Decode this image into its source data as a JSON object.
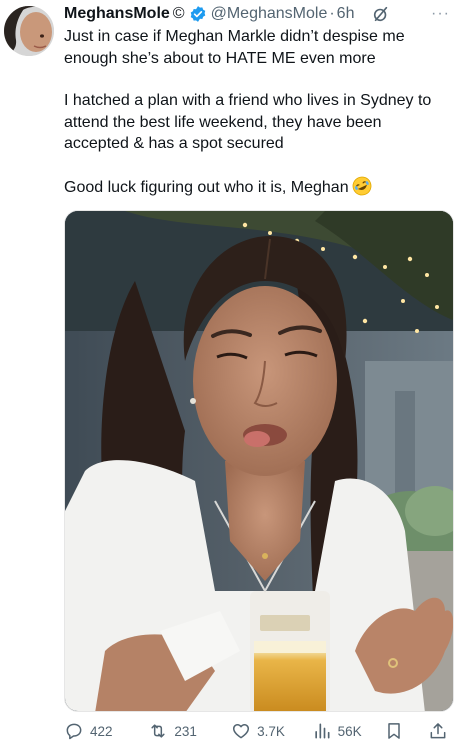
{
  "author": {
    "display_name": "MeghansMole",
    "name_suffix": "©",
    "handle": "@MeghansMole",
    "separator": "·",
    "time": "6h",
    "verified": true
  },
  "icons": {
    "verified": "verified-badge-icon",
    "grok": "grok-icon",
    "more": "more-options-icon",
    "emoji": "rolling-on-floor-laughing-emoji",
    "reply": "reply-icon",
    "retweet": "retweet-icon",
    "like": "heart-icon",
    "views": "views-icon",
    "bookmark": "bookmark-icon",
    "share": "share-icon"
  },
  "more_label": "···",
  "tweet": {
    "paragraph1": "Just in case if Meghan Markle didn’t despise me enough she’s about to HATE ME even more",
    "paragraph2": "I hatched a plan with a friend who lives in Sydney to attend the best life weekend, they have been accepted & has a spot secured",
    "paragraph3": "Good luck figuring out who it is, Meghan"
  },
  "actions": {
    "replies": "422",
    "retweets": "231",
    "likes": "3.7K",
    "views": "56K"
  },
  "colors": {
    "text": "#0f1419",
    "secondary": "#536471",
    "verified": "#1d9bf0"
  }
}
